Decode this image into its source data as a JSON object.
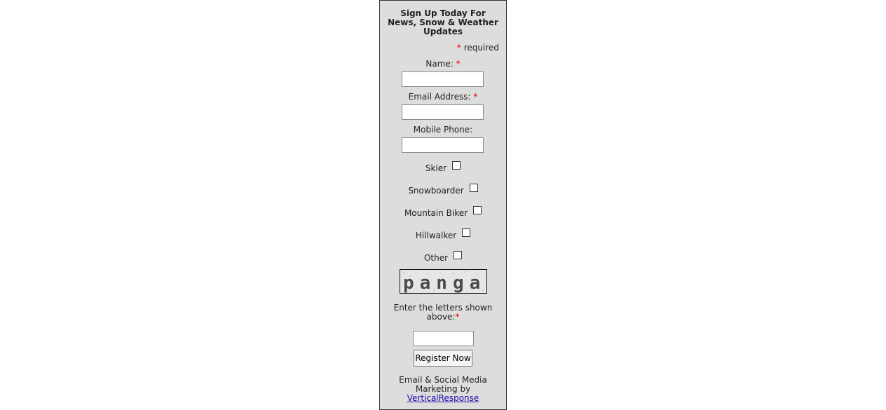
{
  "form": {
    "title": "Sign Up Today For News, Snow & Weather Updates",
    "required_note": "required",
    "required_star": "*",
    "fields": [
      {
        "label": "Name:",
        "required": true,
        "value": ""
      },
      {
        "label": "Email Address:",
        "required": true,
        "value": ""
      },
      {
        "label": "Mobile Phone:",
        "required": false,
        "value": ""
      }
    ],
    "interests": [
      {
        "label": "Skier",
        "checked": false
      },
      {
        "label": "Snowboarder",
        "checked": false
      },
      {
        "label": "Mountain Biker",
        "checked": false
      },
      {
        "label": "Hillwalker",
        "checked": false
      },
      {
        "label": "Other",
        "checked": false
      }
    ],
    "captcha": {
      "image_text": "panga",
      "prompt": "Enter the letters shown above:",
      "value": ""
    },
    "submit_label": "Register Now"
  },
  "footer": {
    "text": "Email & Social Media Marketing by",
    "link_text": "VerticalResponse"
  }
}
